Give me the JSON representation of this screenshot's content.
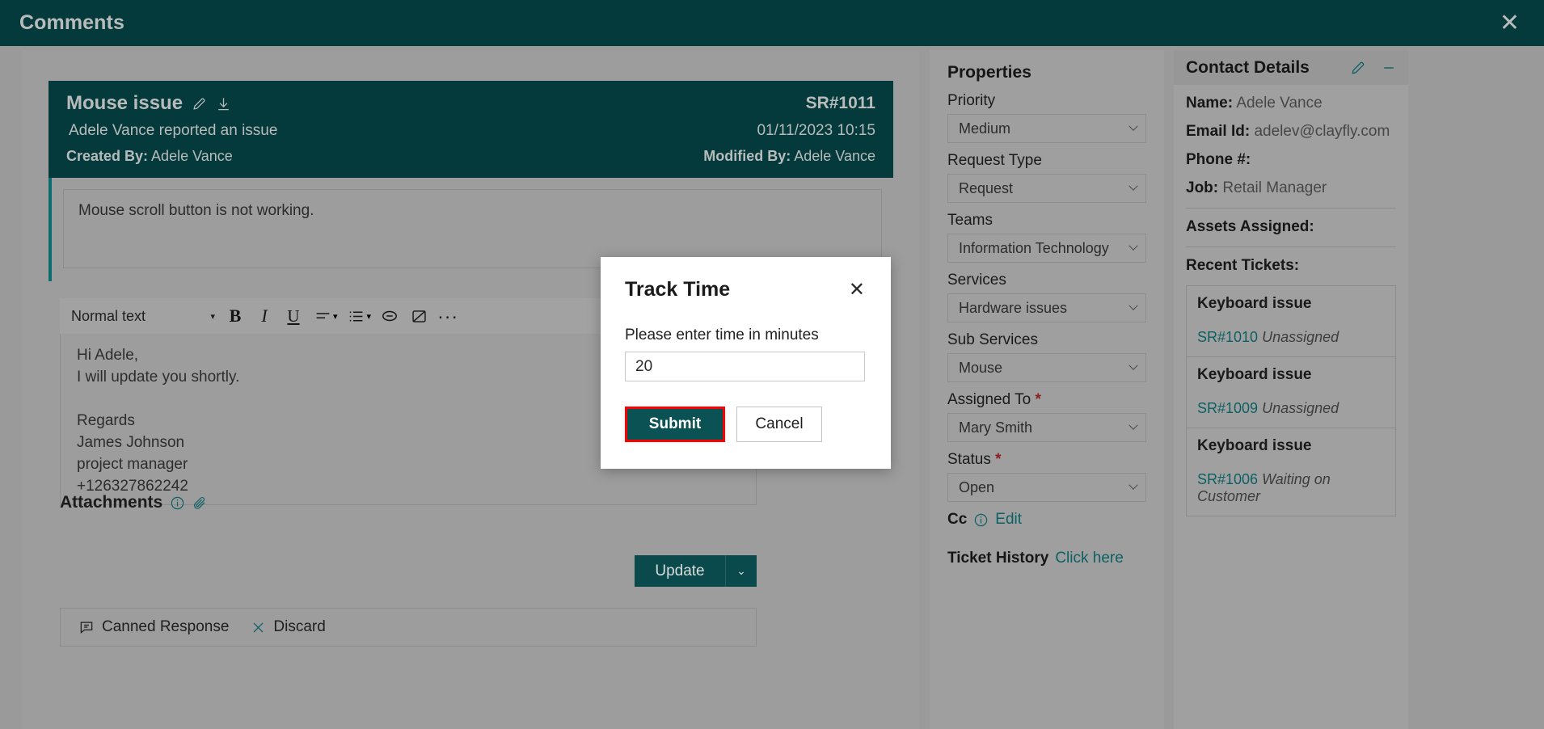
{
  "topbar": {
    "title": "Comments",
    "close_label": "✕"
  },
  "ticket": {
    "title": "Mouse issue",
    "sr_number": "SR#1011",
    "reported_line": "Adele Vance reported an issue",
    "datetime": "01/11/2023 10:15",
    "created_by_label": "Created By:",
    "created_by": "Adele Vance",
    "modified_by_label": "Modified By:",
    "modified_by": "Adele Vance",
    "description": "Mouse scroll button is not working."
  },
  "editor": {
    "style_name": "Normal text",
    "body": "Hi Adele,\nI will update you shortly.\n\nRegards\nJames Johnson\nproject manager\n+126327862242",
    "toolbar": {
      "bold": "B",
      "italic": "I",
      "underline": "U",
      "more": "···",
      "caret": "▾"
    }
  },
  "attachments": {
    "label": "Attachments"
  },
  "actions": {
    "update_label": "Update",
    "update_caret": "⌄",
    "canned_response": "Canned Response",
    "discard": "Discard"
  },
  "properties": {
    "title": "Properties",
    "fields": [
      {
        "label": "Priority",
        "value": "Medium",
        "required": false
      },
      {
        "label": "Request Type",
        "value": "Request",
        "required": false
      },
      {
        "label": "Teams",
        "value": "Information Technology",
        "required": false
      },
      {
        "label": "Services",
        "value": "Hardware issues",
        "required": false
      },
      {
        "label": "Sub Services",
        "value": "Mouse",
        "required": false
      },
      {
        "label": "Assigned To",
        "value": "Mary Smith",
        "required": true
      },
      {
        "label": "Status",
        "value": "Open",
        "required": true
      }
    ],
    "cc_label": "Cc",
    "cc_link": "Edit",
    "history_label": "Ticket History",
    "history_link": "Click here",
    "required_marker": "*"
  },
  "contact": {
    "title": "Contact Details",
    "name_label": "Name:",
    "name": "Adele Vance",
    "email_label": "Email Id:",
    "email": "adelev@clayfly.com",
    "phone_label": "Phone #:",
    "phone": "",
    "job_label": "Job:",
    "job": "Retail Manager",
    "assets_label": "Assets Assigned:",
    "recent_label": "Recent Tickets:",
    "recent_tickets": [
      {
        "title": "Keyboard issue",
        "id": "SR#1010",
        "status": "Unassigned"
      },
      {
        "title": "Keyboard issue",
        "id": "SR#1009",
        "status": "Unassigned"
      },
      {
        "title": "Keyboard issue",
        "id": "SR#1006",
        "status": "Waiting on Customer"
      }
    ]
  },
  "modal": {
    "title": "Track Time",
    "close_label": "✕",
    "field_label": "Please enter time in minutes",
    "input_value": "20",
    "submit_label": "Submit",
    "cancel_label": "Cancel",
    "highlight_color": "#ff0000"
  },
  "colors": {
    "brand_dark": "#053a3c",
    "accent_teal": "#0d6063",
    "page_bg": "#9a9a9a"
  }
}
